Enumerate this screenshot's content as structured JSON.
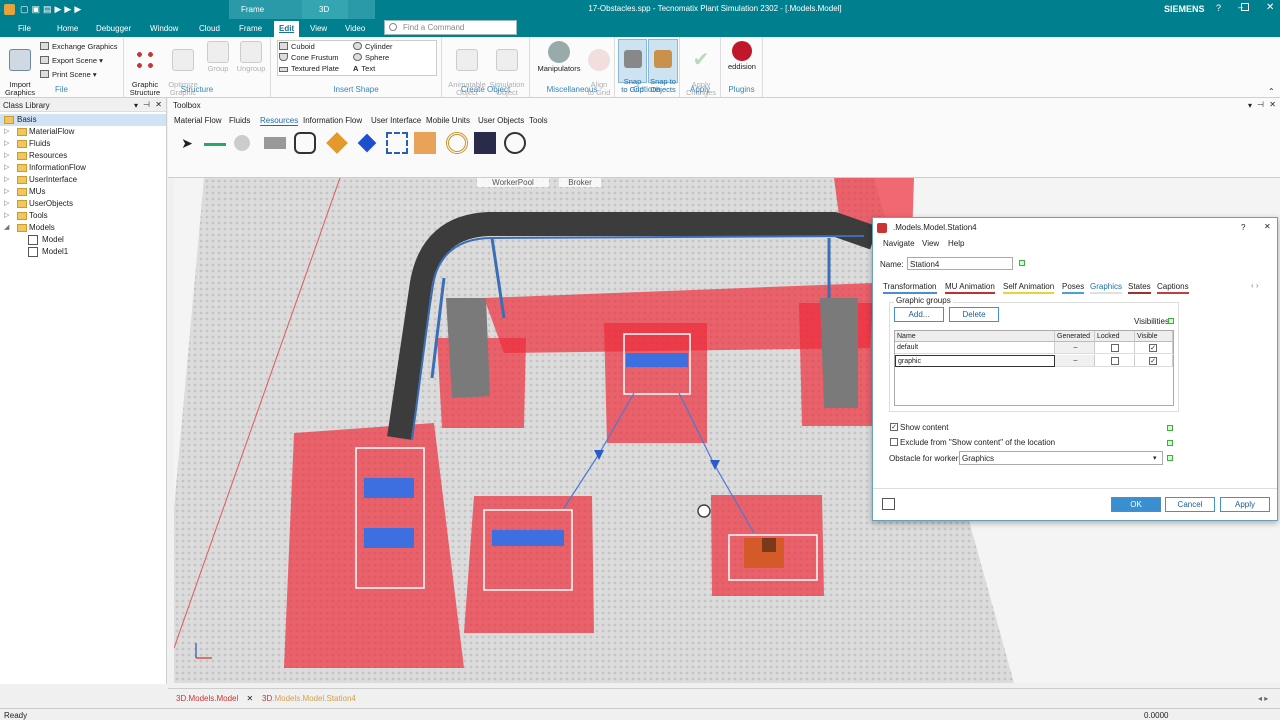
{
  "titlebar": {
    "title": "17-Obstacles.spp - Tecnomatix Plant Simulation 2302 - [.Models.Model]",
    "brand": "SIEMENS",
    "context_frame": "Frame",
    "context_3d": "3D"
  },
  "ribbon_tabs": [
    "File",
    "Home",
    "Debugger",
    "Window",
    "Cloud",
    "Frame",
    "Edit",
    "View",
    "Video"
  ],
  "find_command": {
    "placeholder": "Find a Command"
  },
  "ribbon": {
    "file": {
      "label": "File",
      "import": "Import\nGraphics",
      "exchange": "Exchange Graphics",
      "export": "Export Scene",
      "print": "Print Scene"
    },
    "structure": {
      "label": "Structure",
      "graphic_structure": "Graphic\nStructure",
      "optimize": "Optimize\nGraphic",
      "group": "Group",
      "ungroup": "Ungroup"
    },
    "insert_shape": {
      "label": "Insert Shape",
      "cuboid": "Cuboid",
      "cone": "Cone Frustum",
      "plate": "Textured Plate",
      "cylinder": "Cylinder",
      "sphere": "Sphere",
      "text": "Text"
    },
    "create_object": {
      "label": "Create Object",
      "animatable": "Animatable\nObject",
      "simulation": "Simulation\nObject"
    },
    "misc": {
      "label": "Miscellaneous",
      "manipulators": "Manipulators",
      "align": "Align\nto Grid"
    },
    "options": {
      "label": "Options",
      "snap_grid": "Snap\nto Grid",
      "snap_objects": "Snap to\nObjects"
    },
    "apply": {
      "label": "Apply",
      "apply_changes": "Apply\nChanges"
    },
    "plugins": {
      "label": "Plugins",
      "eddision": "eddision"
    }
  },
  "class_library": {
    "title": "Class Library",
    "items": [
      {
        "label": "Basis",
        "level": 0,
        "kind": "root"
      },
      {
        "label": "MaterialFlow",
        "level": 1,
        "kind": "folder"
      },
      {
        "label": "Fluids",
        "level": 1,
        "kind": "folder"
      },
      {
        "label": "Resources",
        "level": 1,
        "kind": "folder"
      },
      {
        "label": "InformationFlow",
        "level": 1,
        "kind": "folder"
      },
      {
        "label": "UserInterface",
        "level": 1,
        "kind": "folder"
      },
      {
        "label": "MUs",
        "level": 1,
        "kind": "folder"
      },
      {
        "label": "UserObjects",
        "level": 1,
        "kind": "folder"
      },
      {
        "label": "Tools",
        "level": 1,
        "kind": "folder"
      },
      {
        "label": "Models",
        "level": 1,
        "kind": "folder-open"
      },
      {
        "label": "Model",
        "level": 2,
        "kind": "model"
      },
      {
        "label": "Model1",
        "level": 2,
        "kind": "model"
      }
    ]
  },
  "toolbox": {
    "title": "Toolbox",
    "tabs": [
      "Material Flow",
      "Fluids",
      "Resources",
      "Information Flow",
      "User Interface",
      "Mobile Units",
      "User Objects",
      "Tools"
    ],
    "active_tab": "Resources",
    "tools": [
      "pointer-icon",
      "connector-icon",
      "workerpool-icon",
      "footpath-icon",
      "worker-icon",
      "broker-icon",
      "workplace-icon",
      "obstacle-icon",
      "exporter-icon",
      "shift-calendar-icon",
      "importer-icon",
      "stop-icon"
    ]
  },
  "viewport": {
    "label_workerpool": "WorkerPool",
    "label_broker": "Broker"
  },
  "dialog": {
    "title": ".Models.Model.Station4",
    "menu": [
      "Navigate",
      "View",
      "Help"
    ],
    "name_label": "Name:",
    "name_value": "Station4",
    "tabs": [
      "Transformation",
      "MU Animation",
      "Self Animation",
      "Poses",
      "Graphics",
      "States",
      "Captions"
    ],
    "active_tab": "Graphics",
    "group_title": "Graphic groups",
    "add": "Add...",
    "delete": "Delete",
    "visibilities": "Visibilities",
    "columns": [
      "Name",
      "Generated",
      "Locked",
      "Visible"
    ],
    "rows": [
      {
        "name": "default",
        "generated": "–",
        "locked": false,
        "visible": true
      },
      {
        "name": "graphic",
        "generated": "–",
        "locked": false,
        "visible": true
      }
    ],
    "show_content": "Show content",
    "exclude": "Exclude from \"Show content\" of the location",
    "obstacle_label": "Obstacle for worker:",
    "obstacle_value": "Graphics",
    "ok": "OK",
    "cancel": "Cancel",
    "apply": "Apply"
  },
  "doc_tabs": [
    {
      "prefix": "3D",
      "label": ".Models.Model",
      "active": true
    },
    {
      "prefix": "3D",
      "label": ".Models.Model.Station4",
      "active": false
    }
  ],
  "status": {
    "left": "Ready",
    "right": "0.0000"
  }
}
